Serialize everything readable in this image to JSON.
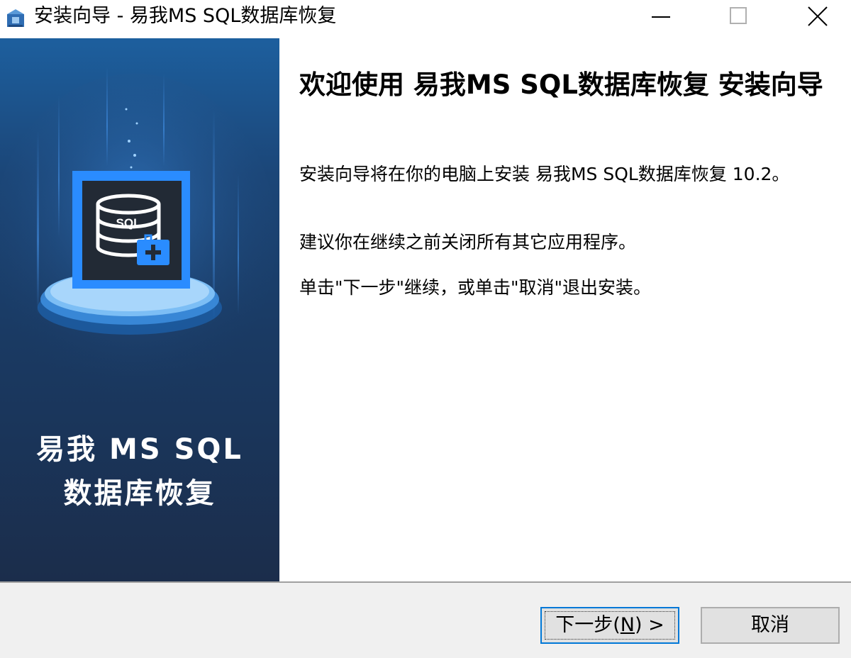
{
  "window": {
    "title": "安装向导 - 易我MS SQL数据库恢复"
  },
  "banner": {
    "line1": "易我 MS SQL",
    "line2": "数据库恢复",
    "db_label": "SQL"
  },
  "content": {
    "heading": "欢迎使用 易我MS SQL数据库恢复 安装向导",
    "para1": "安装向导将在你的电脑上安装 易我MS SQL数据库恢复 10.2。",
    "para2": "建议你在继续之前关闭所有其它应用程序。",
    "para3": "单击\"下一步\"继续，或单击\"取消\"退出安装。"
  },
  "buttons": {
    "next_prefix": "下一步(",
    "next_accel": "N",
    "next_suffix": ") >",
    "cancel": "取消"
  },
  "icons": {
    "app": "installer-app-icon",
    "minimize": "minimize-icon",
    "maximize": "maximize-icon",
    "close": "close-icon",
    "database": "database-icon",
    "medical_kit": "medical-kit-icon"
  },
  "colors": {
    "banner_top": "#1d5f9e",
    "banner_bottom": "#1b2d4b",
    "accent": "#0078d7",
    "footer_bg": "#f0f0f0"
  }
}
